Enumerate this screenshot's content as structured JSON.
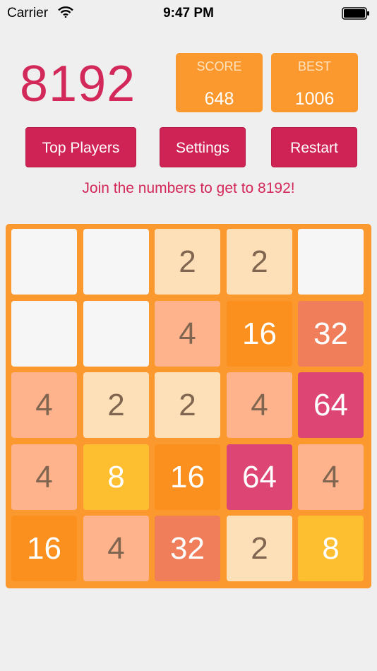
{
  "status_bar": {
    "carrier": "Carrier",
    "time": "9:47 PM"
  },
  "header": {
    "title": "8192"
  },
  "score": {
    "label": "SCORE",
    "value": "648"
  },
  "best": {
    "label": "BEST",
    "value": "1006"
  },
  "buttons": {
    "top_players": "Top Players",
    "settings": "Settings",
    "restart": "Restart"
  },
  "hint": "Join the numbers to get to 8192!",
  "board": {
    "rows": [
      [
        "",
        "",
        "2",
        "2",
        ""
      ],
      [
        "",
        "",
        "4",
        "16",
        "32"
      ],
      [
        "4",
        "2",
        "2",
        "4",
        "64"
      ],
      [
        "4",
        "8",
        "16",
        "64",
        "4"
      ],
      [
        "16",
        "4",
        "32",
        "2",
        "8"
      ]
    ]
  },
  "colors": {
    "accent": "#d3295a",
    "board": "#fb992e",
    "tile_2": "#fde0b7",
    "tile_4": "#ffb38c",
    "tile_8": "#fdbf2f",
    "tile_16": "#fb901e",
    "tile_32": "#f17e5a",
    "tile_64": "#dc4574",
    "empty": "#f6f6f6"
  }
}
